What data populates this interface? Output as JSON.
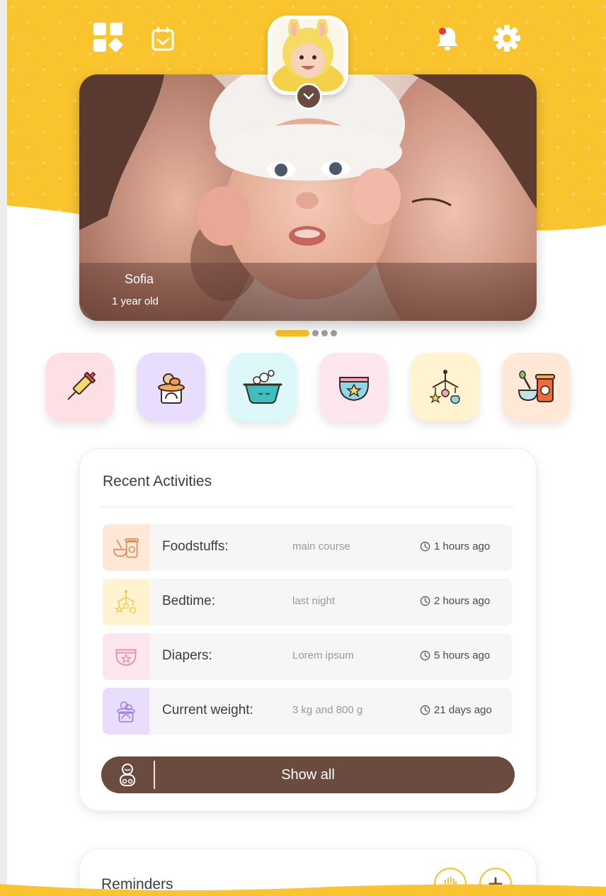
{
  "theme": {
    "yellow": "#FAC42F",
    "brown": "#6B4A3F",
    "pink": "#FDE0E3",
    "purple": "#E8DDFC",
    "cyan": "#DDF8F8",
    "light_pink": "#FDE6EE",
    "light_yellow": "#FFF3D0",
    "peach": "#FFE9D6"
  },
  "top_bar": {
    "left_icons": [
      "dashboard-icon",
      "calendar-icon"
    ],
    "right_icons": [
      "notification-bell-icon",
      "settings-gear-icon"
    ]
  },
  "profile": {
    "name": "Sofia",
    "age": "1 year old"
  },
  "pager": {
    "active": 1,
    "total": 4
  },
  "categories": [
    {
      "icon": "vaccine-syringe-icon",
      "color": "#FDE0E3"
    },
    {
      "icon": "weight-scale-icon",
      "color": "#E8DDFC"
    },
    {
      "icon": "bath-tub-icon",
      "color": "#DDF8F8"
    },
    {
      "icon": "diaper-icon",
      "color": "#FDE6EE"
    },
    {
      "icon": "crib-mobile-icon",
      "color": "#FFF3D0"
    },
    {
      "icon": "baby-food-icon",
      "color": "#FFE9D6"
    }
  ],
  "recent_activities": {
    "title": "Recent Activities",
    "rows": [
      {
        "label": "Foodstuffs:",
        "value": "main course",
        "time": "1 hours ago",
        "icon": "baby-food-icon"
      },
      {
        "label": "Bedtime:",
        "value": "last night",
        "time": "2 hours ago",
        "icon": "crib-mobile-icon"
      },
      {
        "label": "Diapers:",
        "value": "Lorem ipsum",
        "time": "5 hours ago",
        "icon": "diaper-icon"
      },
      {
        "label": "Current weight:",
        "value": "3 kg and 800 g",
        "time": "21 days ago",
        "icon": "weight-scale-icon"
      }
    ],
    "show_all_label": "Show all"
  },
  "reminders": {
    "title": "Reminders"
  }
}
